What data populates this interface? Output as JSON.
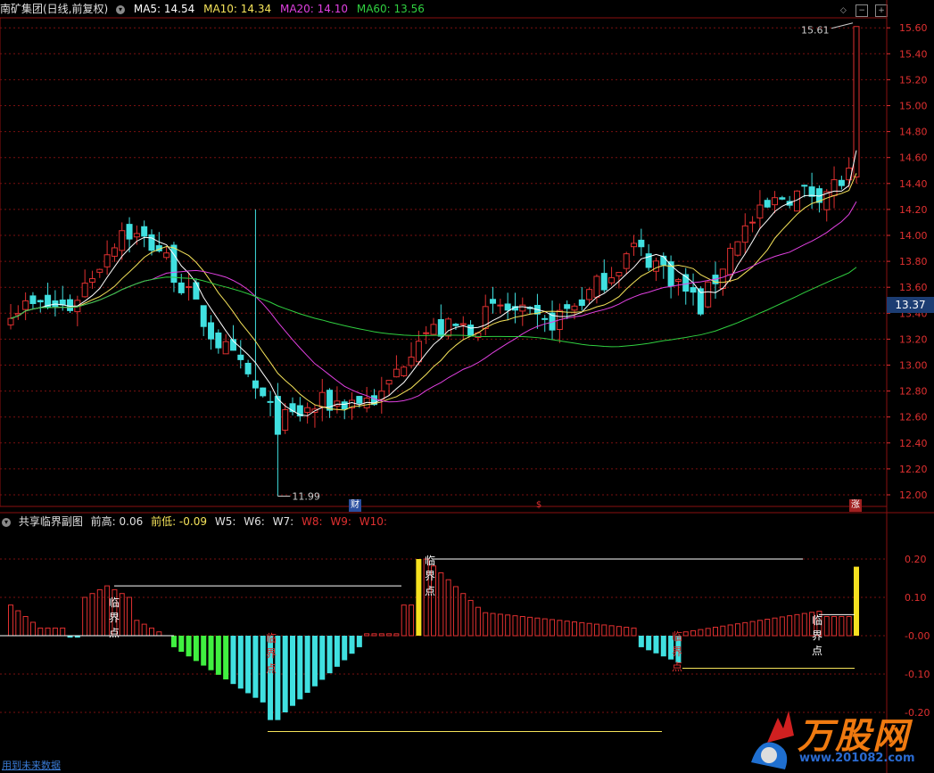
{
  "header": {
    "stock_title": "南矿集团(日线,前复权)",
    "ma": [
      {
        "label": "MA5: 14.54",
        "color": "#ffffff"
      },
      {
        "label": "MA10: 14.34",
        "color": "#f5e35a"
      },
      {
        "label": "MA20: 14.10",
        "color": "#e040e0"
      },
      {
        "label": "MA60: 13.56",
        "color": "#30d040"
      }
    ]
  },
  "price_axis": {
    "ticks": [
      "15.60",
      "15.40",
      "15.20",
      "15.00",
      "14.80",
      "14.60",
      "14.40",
      "14.20",
      "14.00",
      "13.80",
      "13.60",
      "13.40",
      "13.20",
      "13.00",
      "12.80",
      "12.60",
      "12.40",
      "12.20",
      "12.00"
    ],
    "current_price": "13.37",
    "high_marker": "15.61",
    "low_marker": "11.99"
  },
  "events": {
    "cai": "财",
    "dollar": "$",
    "zhang": "涨"
  },
  "indicator": {
    "title": "共享临界副图",
    "items": [
      {
        "label": "前高: 0.06",
        "color": "#e0e0e0"
      },
      {
        "label": "前低: -0.09",
        "color": "#f5e35a"
      },
      {
        "label": "W5:",
        "color": "#e0e0e0"
      },
      {
        "label": "W6:",
        "color": "#e0e0e0"
      },
      {
        "label": "W7:",
        "color": "#e0e0e0"
      },
      {
        "label": "W8:",
        "color": "#e03030"
      },
      {
        "label": "W9:",
        "color": "#e03030"
      },
      {
        "label": "W10:",
        "color": "#e03030"
      }
    ],
    "ticks": [
      "0.20",
      "0.10",
      "-0.00",
      "-0.10",
      "-0.20"
    ],
    "annotations": {
      "lin": "临",
      "jie": "界",
      "dian": "点"
    }
  },
  "footer_note": "用到未来数据",
  "logo": {
    "brand": "万股网",
    "url": "www.201082.com"
  },
  "colors": {
    "up": "#e03030",
    "down": "#40e0e0",
    "grid": "#7a1010",
    "ma5": "#ffffff",
    "ma10": "#f5e35a",
    "ma20": "#e040e0",
    "ma60": "#30d040",
    "bar_green": "#40f040",
    "bar_yellow": "#f5e020"
  }
}
